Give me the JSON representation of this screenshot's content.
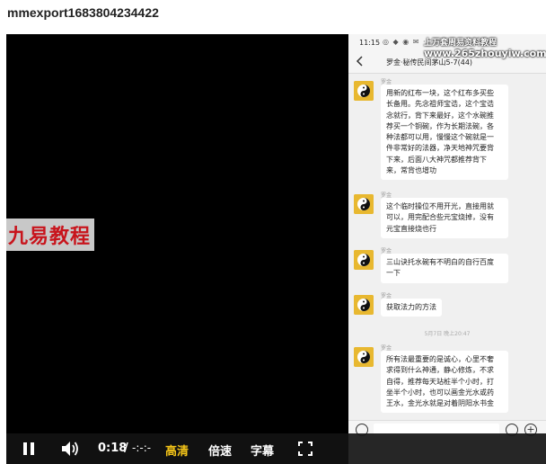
{
  "page": {
    "title": "mmexport1683804234422"
  },
  "watermarks": {
    "left": "九易教程",
    "top_line1": "上万套周易资料教程",
    "top_line2": "www.265zhouyiw.com"
  },
  "phone": {
    "status_time": "11:15",
    "status_icons": "◎ ◆ ◉ ✉ ·",
    "chat_title": "罗金·秘传民间茅山5-7(44)",
    "messages": [
      {
        "sender": "罗金",
        "lines": [
          "用新的红布一块，这个红布多买些",
          "长备用。先念祖师宝诰，这个宝诰",
          "念就行，背下来最好，这个水碗推",
          "荐买一个铜碗，作为长期法碗，各",
          "种法都可以用，慢慢这个碗就是一",
          "件非常好的法器，净天地神咒要背",
          "下来，后面八大神咒都推荐背下",
          "来，常背也增功"
        ]
      },
      {
        "sender": "罗金",
        "lines": [
          "这个临时操位不用开光，直接用就",
          "可以，用完配合些元宝烧掉，没有",
          "元宝直接烧也行"
        ]
      },
      {
        "sender": "罗金",
        "lines": [
          "三山诀托水碗有不明白的自行百度",
          "一下"
        ]
      },
      {
        "sender": "罗金",
        "lines": [
          "获取法力的方法"
        ]
      },
      {
        "sender": "罗金",
        "lines": [
          "所有法最重要的是诚心，心里不奢",
          "求得到什么神通，静心修炼，不求",
          "自得，推荐每天站桩半个小时，打",
          "坐半个小时，也可以画金光水或药",
          "王水，金光水就是对着阴阳水书金"
        ]
      }
    ],
    "timestamp": "5月7日 晚上20:47"
  },
  "controls": {
    "current_time": "0:18",
    "separator": "/",
    "total_time": "-:-:-",
    "quality": "高清",
    "speed": "倍速",
    "subtitles": "字幕"
  },
  "colors": {
    "accent": "#f5c518",
    "watermark_red": "#c8141c"
  },
  "icons": {
    "pause": "pause-icon",
    "volume": "volume-icon",
    "fullscreen": "fullscreen-icon",
    "back": "back-icon",
    "avatar": "taiji-avatar-icon"
  }
}
